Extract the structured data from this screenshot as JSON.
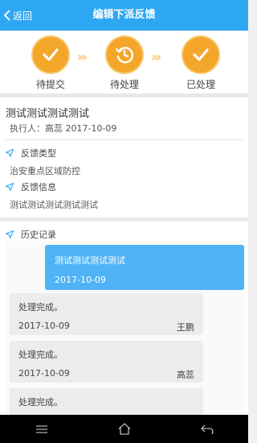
{
  "header": {
    "back_label": "返回",
    "title": "编辑下派反馈"
  },
  "steps": [
    {
      "label": "待提交",
      "icon": "check-icon"
    },
    {
      "label": "待处理",
      "icon": "clock-icon"
    },
    {
      "label": "已处理",
      "icon": "check-icon"
    }
  ],
  "detail": {
    "title": "测试测试测试测试",
    "executor": "执行人：高蕊  2017-10-09",
    "feedback_type_label": "反馈类型",
    "feedback_type_value": "治安重点区域防控",
    "feedback_info_label": "反馈信息",
    "feedback_info_value": "测试测试测试测试测试"
  },
  "history": {
    "title": "历史记录",
    "mine": {
      "text": "测试测试测试测试",
      "date": "2017-10-09"
    },
    "records": [
      {
        "text": "处理完成。",
        "date": "2017-10-09",
        "name": "王鹏"
      },
      {
        "text": "处理完成。",
        "date": "2017-10-09",
        "name": "高蕊"
      },
      {
        "text": "处理完成。",
        "date": "",
        "name": ""
      }
    ]
  },
  "colors": {
    "primary": "#2ea7f3",
    "step": "#f4a62a",
    "bubble_me": "#4fb3f6",
    "bubble": "#ececec"
  }
}
